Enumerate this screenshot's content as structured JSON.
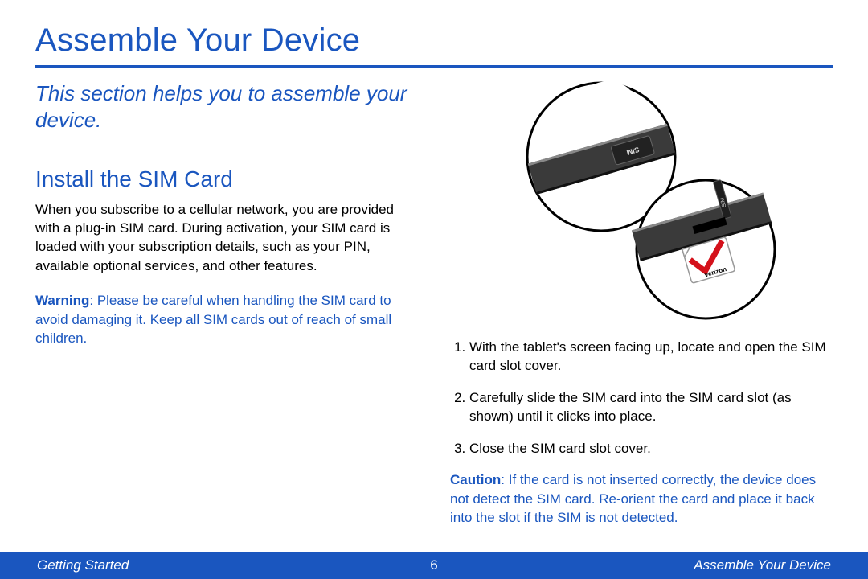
{
  "page": {
    "title": "Assemble Your Device",
    "intro": "This section helps you to assemble your device.",
    "section_heading": "Install the SIM Card",
    "paragraph": "When you subscribe to a cellular network, you are provided with a plug-in SIM card. During activation, your SIM card is loaded with your subscription details, such as your PIN, available optional services, and other features.",
    "warning_label": "Warning",
    "warning_text": ": Please be careful when handling the SIM card to avoid damaging it. Keep all SIM cards out of reach of small children.",
    "steps": [
      "With the tablet's screen facing up, locate and open the SIM card slot cover.",
      "Carefully slide the SIM card into the SIM card slot (as shown) until it clicks into place.",
      "Close the SIM card slot cover."
    ],
    "caution_label": "Caution",
    "caution_text": ": If the card is not inserted correctly, the device does not detect the SIM card. Re-orient the card and place it back into the slot if the SIM is not detected.",
    "illustration": {
      "sim_label_top": "SIM",
      "sim_label_insert": "SIM",
      "carrier": "verizon"
    }
  },
  "footer": {
    "left": "Getting Started",
    "page_number": "6",
    "right": "Assemble Your Device"
  },
  "colors": {
    "brand_blue": "#1a56bf"
  }
}
